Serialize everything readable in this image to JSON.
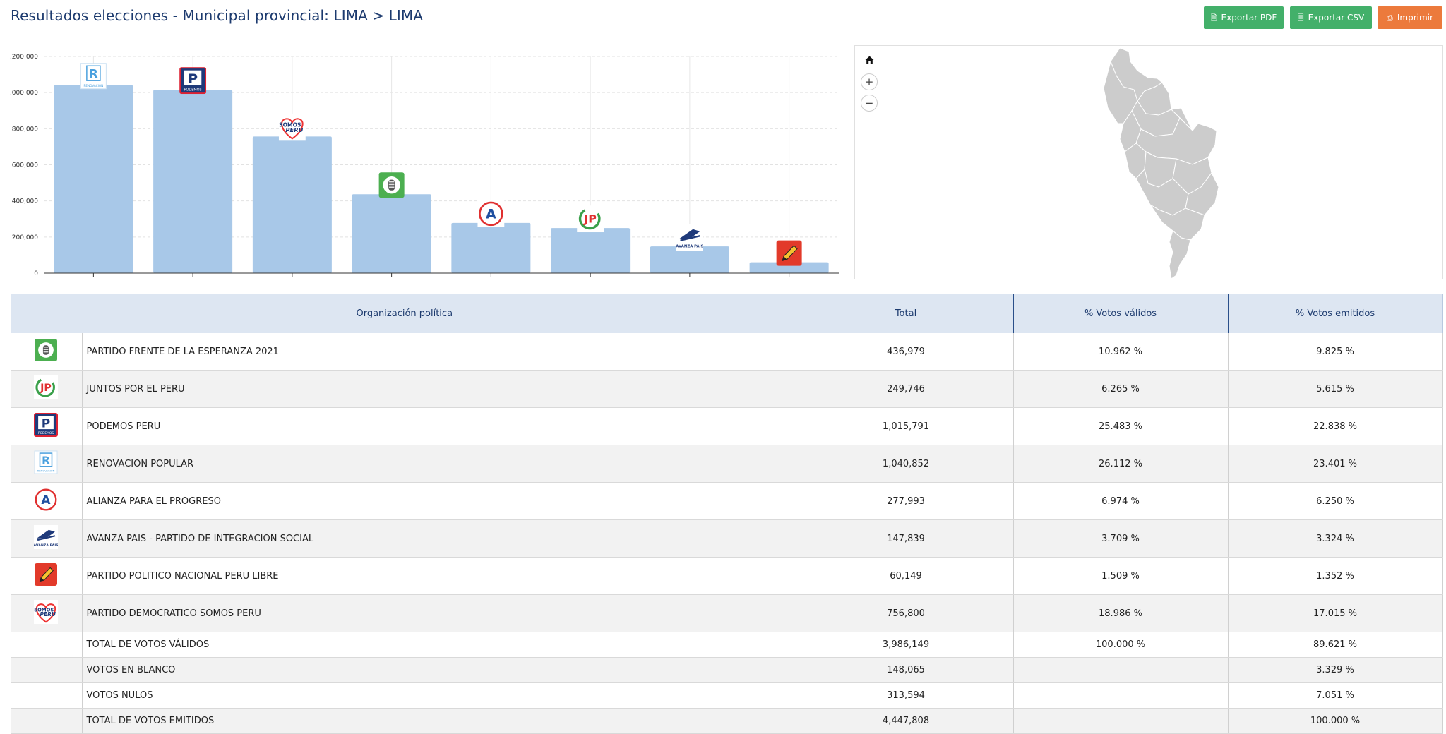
{
  "page": {
    "title": "Resultados elecciones - Municipal provincial: LIMA > LIMA"
  },
  "toolbar": {
    "pdf_label": "Exportar PDF",
    "pdf_icon": "file-pdf-icon",
    "csv_label": "Exportar CSV",
    "csv_icon": "file-excel-icon",
    "print_label": "Imprimir",
    "print_icon": "printer-icon",
    "colors": {
      "export": "#43b06a",
      "print": "#ec7a3c"
    }
  },
  "map": {
    "controls": {
      "home_icon": "home-icon",
      "zoom_in_label": "+",
      "zoom_out_label": "−"
    },
    "region_color": "#cccccc"
  },
  "chart_data": {
    "type": "bar",
    "categories": [
      "RENOVACION POPULAR",
      "PODEMOS PERU",
      "PARTIDO DEMOCRATICO SOMOS PERU",
      "PARTIDO FRENTE DE LA ESPERANZA 2021",
      "ALIANZA PARA EL PROGRESO",
      "JUNTOS POR EL PERU",
      "AVANZA PAIS - PARTIDO DE INTEGRACION SOCIAL",
      "PARTIDO POLITICO NACIONAL PERU LIBRE"
    ],
    "category_logos": [
      "renovacion-popular-logo",
      "podemos-peru-logo",
      "somos-peru-logo",
      "frente-esperanza-logo",
      "alianza-progreso-logo",
      "juntos-por-el-peru-logo",
      "avanza-pais-logo",
      "peru-libre-logo"
    ],
    "values": [
      1040852,
      1015791,
      756800,
      436979,
      277993,
      249746,
      147839,
      60149
    ],
    "ylim": [
      0,
      1200000
    ],
    "yticks": [
      0,
      200000,
      400000,
      600000,
      800000,
      1000000,
      1200000
    ],
    "ytick_labels": [
      "0",
      "200,000",
      "400,000",
      "600,000",
      "800,000",
      ",000,000",
      ",200,000"
    ],
    "grid": true,
    "bar_color": "#a8c8e8"
  },
  "table": {
    "headers": {
      "party": "Organización política",
      "total": "Total",
      "valid": "% Votos válidos",
      "emitted": "% Votos emitidos"
    },
    "rows": [
      {
        "logo": "frente-esperanza-logo",
        "name": "PARTIDO FRENTE DE LA ESPERANZA 2021",
        "total": "436,979",
        "valid": "10.962 %",
        "emitted": "9.825 %"
      },
      {
        "logo": "juntos-por-el-peru-logo",
        "name": "JUNTOS POR EL PERU",
        "total": "249,746",
        "valid": "6.265 %",
        "emitted": "5.615 %"
      },
      {
        "logo": "podemos-peru-logo",
        "name": "PODEMOS PERU",
        "total": "1,015,791",
        "valid": "25.483 %",
        "emitted": "22.838 %"
      },
      {
        "logo": "renovacion-popular-logo",
        "name": "RENOVACION POPULAR",
        "total": "1,040,852",
        "valid": "26.112 %",
        "emitted": "23.401 %"
      },
      {
        "logo": "alianza-progreso-logo",
        "name": "ALIANZA PARA EL PROGRESO",
        "total": "277,993",
        "valid": "6.974 %",
        "emitted": "6.250 %"
      },
      {
        "logo": "avanza-pais-logo",
        "name": "AVANZA PAIS - PARTIDO DE INTEGRACION SOCIAL",
        "total": "147,839",
        "valid": "3.709 %",
        "emitted": "3.324 %"
      },
      {
        "logo": "peru-libre-logo",
        "name": "PARTIDO POLITICO NACIONAL PERU LIBRE",
        "total": "60,149",
        "valid": "1.509 %",
        "emitted": "1.352 %"
      },
      {
        "logo": "somos-peru-logo",
        "name": "PARTIDO DEMOCRATICO SOMOS PERU",
        "total": "756,800",
        "valid": "18.986 %",
        "emitted": "17.015 %"
      }
    ],
    "summary": [
      {
        "name": "TOTAL DE VOTOS VÁLIDOS",
        "total": "3,986,149",
        "valid": "100.000 %",
        "emitted": "89.621 %"
      },
      {
        "name": "VOTOS EN BLANCO",
        "total": "148,065",
        "valid": "",
        "emitted": "3.329 %"
      },
      {
        "name": "VOTOS NULOS",
        "total": "313,594",
        "valid": "",
        "emitted": "7.051 %"
      },
      {
        "name": "TOTAL DE VOTOS EMITIDOS",
        "total": "4,447,808",
        "valid": "",
        "emitted": "100.000 %"
      }
    ]
  },
  "logo_text": {
    "renovacion-popular-logo": {
      "letter": "R",
      "sub": "RENOVACION"
    },
    "podemos-peru-logo": {
      "letter": "P",
      "sub": "PODEMOS"
    },
    "somos-peru-logo": {
      "top": "SOMOS",
      "bottom": "PERU"
    },
    "alianza-progreso-logo": {
      "letter": "A"
    },
    "juntos-por-el-peru-logo": {
      "letter": "JP"
    },
    "avanza-pais-logo": {
      "sub": "AVANZA PAIS"
    }
  }
}
